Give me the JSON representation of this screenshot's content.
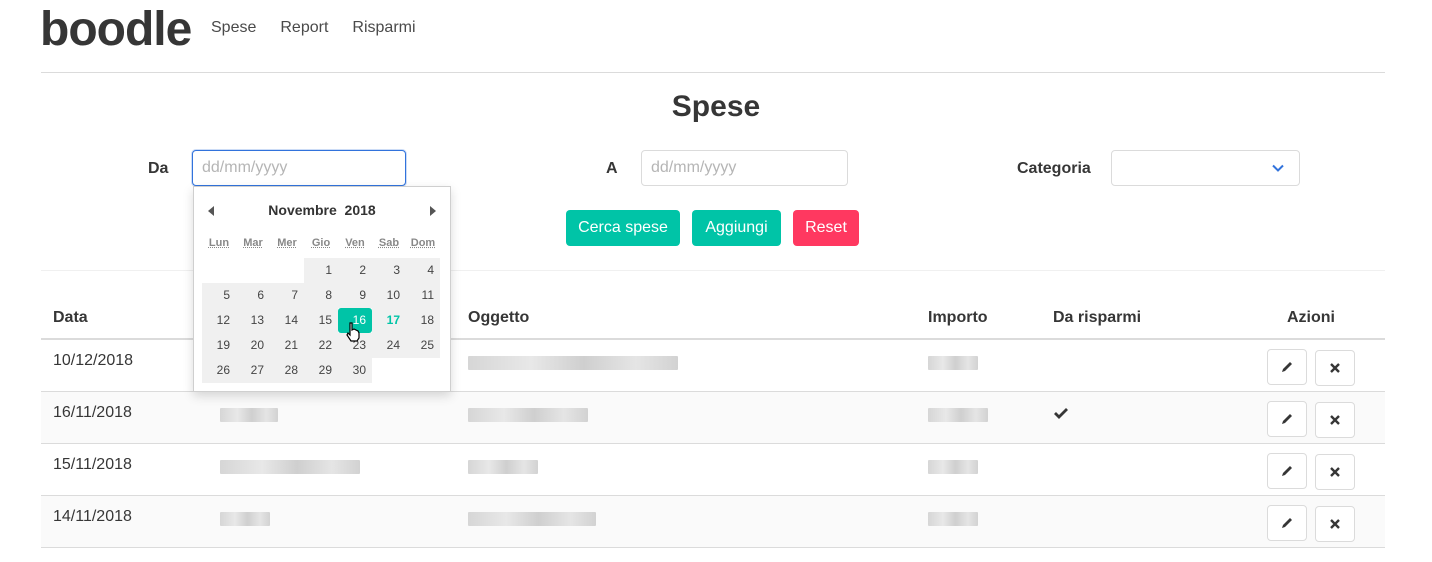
{
  "brand": "boodle",
  "nav": [
    "Spese",
    "Report",
    "Risparmi"
  ],
  "page_title": "Spese",
  "filters": {
    "from_label": "Da",
    "from_placeholder": "dd/mm/yyyy",
    "to_label": "A",
    "to_placeholder": "dd/mm/yyyy",
    "category_label": "Categoria",
    "category_value": ""
  },
  "buttons": {
    "search": "Cerca spese",
    "add": "Aggiungi",
    "reset": "Reset"
  },
  "datepicker": {
    "month": "Novembre",
    "year": "2018",
    "weekdays": [
      "Lun",
      "Mar",
      "Mer",
      "Gio",
      "Ven",
      "Sab",
      "Dom"
    ],
    "selected_day": "16",
    "today": "17"
  },
  "table": {
    "headers": [
      "Data",
      "",
      "Oggetto",
      "Importo",
      "Da risparmi",
      "Azioni"
    ],
    "rows": [
      {
        "date": "10/12/2018",
        "from_savings": false
      },
      {
        "date": "16/11/2018",
        "from_savings": true
      },
      {
        "date": "15/11/2018",
        "from_savings": false
      },
      {
        "date": "14/11/2018",
        "from_savings": false
      }
    ]
  },
  "colors": {
    "teal": "#00c4a7",
    "red": "#ff3860",
    "focus": "#3273dc"
  },
  "icons": [
    "chevron-down-icon",
    "pencil-icon",
    "close-icon",
    "check-icon",
    "arrow-left-icon",
    "arrow-right-icon",
    "hand-cursor-icon"
  ]
}
